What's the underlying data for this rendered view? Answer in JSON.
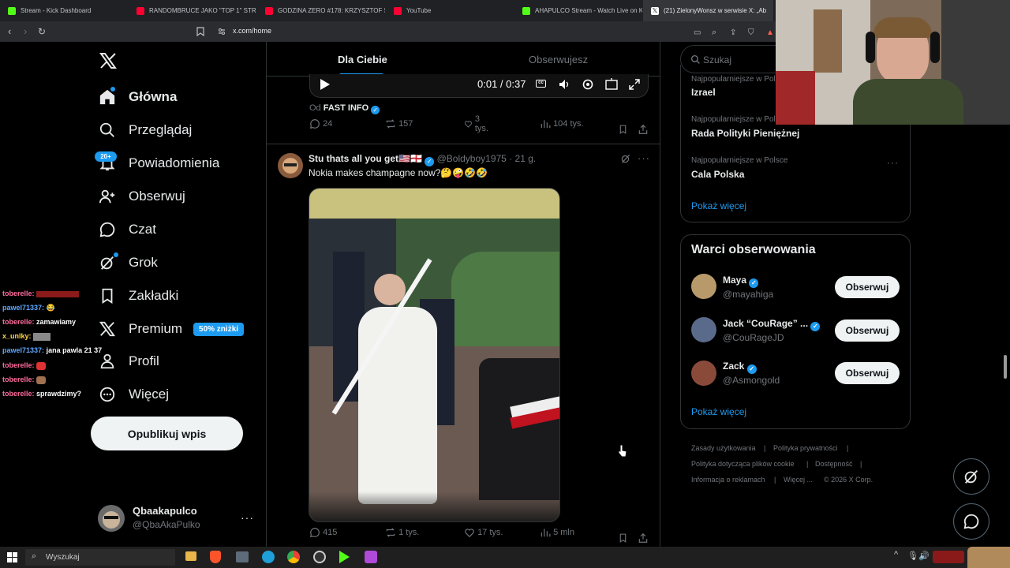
{
  "browser": {
    "tabs": [
      {
        "title": "Stream - Kick Dashboard",
        "color": "#53fc18"
      },
      {
        "title": "RANDOMBRUCE JAKO \"TOP 1\" STR",
        "color": "#ff0033"
      },
      {
        "title": "GODZINA ZERO #178: KRZYSZTOF S",
        "color": "#ff0033"
      },
      {
        "title": "YouTube",
        "color": "#ff0033"
      },
      {
        "title": "AHAPULCO Stream - Watch Live on K",
        "color": "#53fc18"
      },
      {
        "title": "(21) ZielonyWonsz w serwisie X: „Ab",
        "color": "#ffffff"
      }
    ],
    "url": "x.com/home"
  },
  "nav": {
    "items": [
      {
        "label": "Główna",
        "icon": "home-icon"
      },
      {
        "label": "Przeglądaj",
        "icon": "search-icon"
      },
      {
        "label": "Powiadomienia",
        "icon": "bell-icon",
        "badge": "20+"
      },
      {
        "label": "Obserwuj",
        "icon": "follow-icon"
      },
      {
        "label": "Czat",
        "icon": "chat-icon"
      },
      {
        "label": "Grok",
        "icon": "grok-icon"
      },
      {
        "label": "Zakładki",
        "icon": "bookmark-icon"
      },
      {
        "label": "Premium",
        "icon": "x-icon",
        "tag": "50% zniżki"
      },
      {
        "label": "Profil",
        "icon": "profile-icon"
      },
      {
        "label": "Więcej",
        "icon": "more-icon"
      }
    ],
    "post_button": "Opublikuj wpis",
    "account": {
      "name": "Qbaakapulco",
      "handle": "@QbaAkaPulko"
    }
  },
  "feed": {
    "tabs": [
      "Dla Ciebie",
      "Obserwujesz"
    ],
    "video": {
      "time": "0:01 / 0:37",
      "source_prefix": "Od",
      "source_name": "FAST INFO"
    },
    "tweet1_metrics": {
      "replies": "24",
      "reposts": "157",
      "likes": "3 tys.",
      "views": "104 tys."
    },
    "tweet2": {
      "name": "Stu thats all you get🇺🇸🏴󠁧󠁢󠁥󠁮󠁧󠁿",
      "handle": "@Boldyboy1975",
      "time": "· 21 g.",
      "text": "Nokia makes champagne now?🤔🤪🤣🤣",
      "metrics": {
        "replies": "415",
        "reposts": "1 tys.",
        "likes": "17 tys.",
        "views": "5 mln"
      }
    }
  },
  "sidebar": {
    "search_placeholder": "Szukaj",
    "trends": [
      {
        "context": "Najpopularniejsze w Polsce",
        "name": "Izrael"
      },
      {
        "context": "Najpopularniejsze w Polsce",
        "name": "Rada Polityki Pieniężnej"
      },
      {
        "context": "Najpopularniejsze w Polsce",
        "name": "Cala Polska"
      }
    ],
    "show_more": "Pokaż więcej",
    "who_to_follow": {
      "title": "Warci obserwowania",
      "users": [
        {
          "name": "Maya",
          "handle": "@mayahiga"
        },
        {
          "name": "Jack “CouRage” ...",
          "handle": "@CouRageJD"
        },
        {
          "name": "Zack",
          "handle": "@Asmongold"
        }
      ],
      "follow_label": "Obserwuj",
      "show_more": "Pokaż więcej"
    },
    "footer": [
      "Zasady użytkowania",
      "|",
      "Polityka prywatności",
      "|",
      "Polityka dotycząca plików cookie",
      "|",
      "Dostępność",
      "|",
      "Informacja o reklamach",
      "|",
      "Więcej ...",
      "© 2026 X Corp."
    ]
  },
  "chat_overlay": [
    {
      "user": "toberelle:",
      "msg": "",
      "color": "#ff6b9d"
    },
    {
      "user": "pawel71337:",
      "msg": "😂",
      "color": "#5ea8ff"
    },
    {
      "user": "toberelle:",
      "msg": "zamawiamy",
      "color": "#ff6b9d"
    },
    {
      "user": "x_unlky:",
      "msg": "",
      "color": "#ffd54a"
    },
    {
      "user": "pawel71337:",
      "msg": "jana pawla 21 37",
      "color": "#5ea8ff"
    },
    {
      "user": "toberelle:",
      "msg": "",
      "color": "#ff6b9d"
    },
    {
      "user": "toberelle:",
      "msg": "",
      "color": "#ff6b9d"
    },
    {
      "user": "toberelle:",
      "msg": "sprawdzimy?",
      "color": "#ff6b9d"
    }
  ],
  "taskbar": {
    "search_label": "Wyszukaj"
  },
  "colors": {
    "accent": "#1d9bf0",
    "bg": "#000000",
    "border": "#2f3336",
    "muted": "#71767b"
  }
}
